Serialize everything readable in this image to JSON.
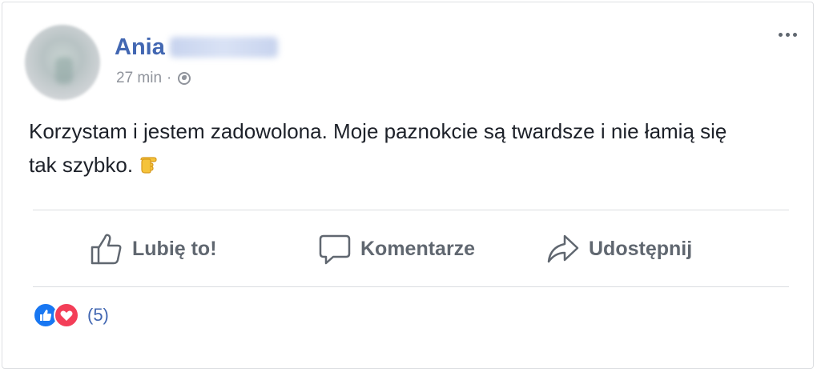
{
  "post": {
    "author_first": "Ania",
    "time": "27 min",
    "separator": "·",
    "text_line1": "Korzystam i jestem zadowolona. Moje paznokcie są twardsze i nie łamią się",
    "text_line2": "tak szybko.",
    "emoji_icon": "backhand-index-pointing-right-emoji"
  },
  "actions": {
    "like_label": "Lubię to!",
    "comment_label": "Komentarze",
    "share_label": "Udostępnij"
  },
  "reactions": {
    "count": "(5)",
    "types": [
      "like-icon",
      "love-icon"
    ]
  },
  "colors": {
    "author_link": "#4267b2",
    "meta_gray": "#90949c",
    "action_gray": "#606770",
    "like_blue": "#1877f2",
    "love_red": "#f33e58"
  }
}
